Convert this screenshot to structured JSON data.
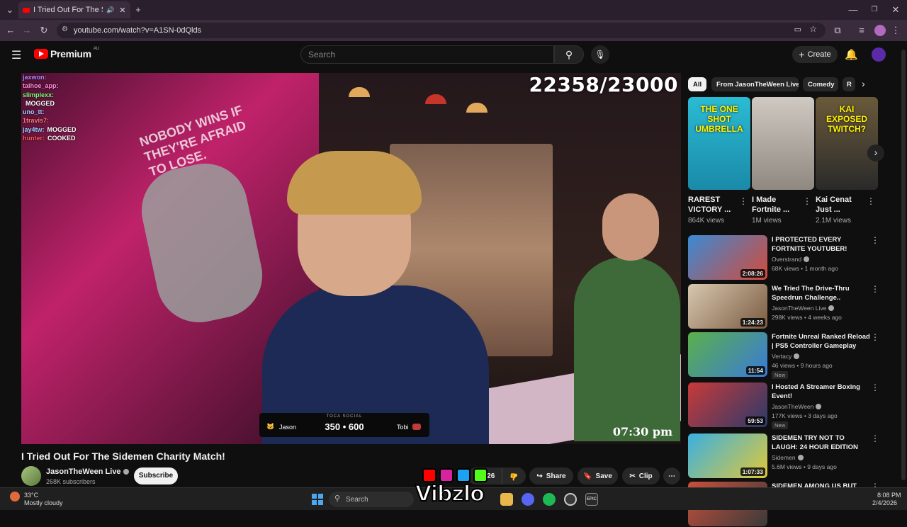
{
  "browser": {
    "tab_title": "I Tried Out For The Sidemen",
    "url": "youtube.com/watch?v=A1SN-0dQlds"
  },
  "youtube": {
    "logo": "Premium",
    "region": "AU",
    "search_placeholder": "Search",
    "create_label": "Create"
  },
  "video": {
    "counter": "22358/23000",
    "chat": [
      {
        "user": "jaxwon:",
        "msg": "",
        "color": "#b388ff"
      },
      {
        "user": "taihoe_app:",
        "msg": "",
        "color": "#ff8ad8"
      },
      {
        "user": "slimplexx:",
        "msg": "",
        "color": "#7dff7a"
      },
      {
        "user": "",
        "msg": "MOGGED",
        "color": "#ffffff"
      },
      {
        "user": "uno_tt:",
        "msg": "",
        "color": "#9fd2ff"
      },
      {
        "user": "1travis7:",
        "msg": "",
        "color": "#ff7a7a"
      },
      {
        "user": "jay4tw:",
        "msg": "MOGGED",
        "color": "#9fd2ff"
      },
      {
        "user": "hunter:",
        "msg": "COOKED",
        "color": "#ff5a5a"
      }
    ],
    "wall_text": "NOBODY WINS IF THEY'RE AFRAID TO LOSE.",
    "scoreboard": {
      "header": "TOCA SOCIAL",
      "left_name": "Jason",
      "score": "350 • 600",
      "right_name": "Tobi"
    },
    "clock": "07:30 pm",
    "title": "I Tried Out For The Sidemen Charity Match!"
  },
  "channel": {
    "name": "JasonTheWeen Live",
    "subscribers": "268K subscribers",
    "subscribe_label": "Subscribe"
  },
  "actions": {
    "like_count": "26",
    "share": "Share",
    "save": "Save",
    "clip": "Clip"
  },
  "chips": [
    "All",
    "From JasonTheWeen Live",
    "Comedy",
    "R"
  ],
  "shorts": [
    {
      "title": "RAREST VICTORY ...",
      "views": "864K views",
      "thumb_text": "THE ONE SHOT UMBRELLA",
      "colors": [
        "#2bbbd4",
        "#1a8aa8"
      ]
    },
    {
      "title": "I Made Fortnite ...",
      "views": "1M views",
      "thumb_text": "",
      "colors": [
        "#cfc9c2",
        "#8f8880"
      ]
    },
    {
      "title": "Kai Cenat Just ...",
      "views": "2.1M views",
      "thumb_text": "KAI EXPOSED TWITCH?",
      "colors": [
        "#6a5a3a",
        "#2a2a2a"
      ]
    }
  ],
  "recommendations": [
    {
      "title": "I PROTECTED EVERY FORTNITE YOUTUBER!",
      "channel": "Overstrand",
      "meta": "68K views • 1 month ago",
      "duration": "2:08:26",
      "badge": "",
      "colors": [
        "#3a8ad4",
        "#d44a3a"
      ]
    },
    {
      "title": "We Tried The Drive-Thru Speedrun Challenge..",
      "channel": "JasonTheWeen Live",
      "meta": "298K views • 4 weeks ago",
      "duration": "1:24:23",
      "badge": "",
      "colors": [
        "#d8c8b0",
        "#7a5a40"
      ]
    },
    {
      "title": "Fortnite Unreal Ranked Reload | PS5 Controller Gameplay",
      "channel": "Vertacy",
      "meta": "46 views • 9 hours ago",
      "duration": "11:54",
      "badge": "New",
      "colors": [
        "#5ab04a",
        "#3a7ad8"
      ]
    },
    {
      "title": "I Hosted A Streamer Boxing Event!",
      "channel": "JasonTheWeen",
      "meta": "177K views • 3 days ago",
      "duration": "59:53",
      "badge": "New",
      "colors": [
        "#c83a3a",
        "#2a3a6a"
      ]
    },
    {
      "title": "SIDEMEN TRY NOT TO LAUGH: 24 HOUR EDITION",
      "channel": "Sidemen",
      "meta": "5.6M views • 9 days ago",
      "duration": "1:07:33",
      "badge": "",
      "colors": [
        "#3ab0e0",
        "#e0c83a"
      ]
    },
    {
      "title": "SIDEMEN AMONG US BUT THE",
      "channel": "",
      "meta": "",
      "duration": "",
      "badge": "",
      "colors": [
        "#c8503a",
        "#3a3a3a"
      ]
    }
  ],
  "taskbar": {
    "temp": "33°C",
    "weather": "Mostly cloudy",
    "search": "Search",
    "time": "8:08 PM",
    "date": "2/4/2026"
  },
  "watermark": "Vibzlo"
}
